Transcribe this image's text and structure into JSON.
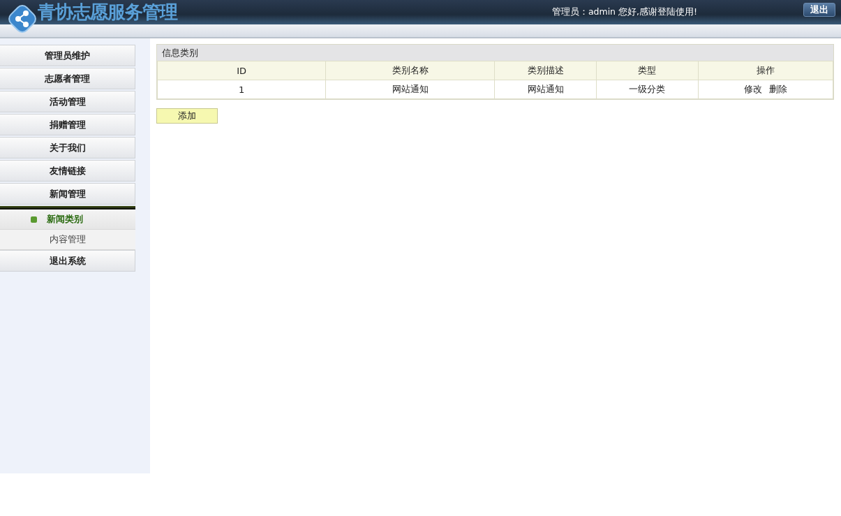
{
  "header": {
    "title": "青协志愿服务管理",
    "greeting": "管理员：admin 您好,感谢登陆使用!",
    "logout_button": "退出"
  },
  "sidebar": {
    "items": [
      {
        "label": "管理员维护"
      },
      {
        "label": "志愿者管理"
      },
      {
        "label": "活动管理"
      },
      {
        "label": "捐赠管理"
      },
      {
        "label": "关于我们"
      },
      {
        "label": "友情链接"
      },
      {
        "label": "新闻管理",
        "expanded": true,
        "children": [
          {
            "label": "新闻类别",
            "selected": true
          },
          {
            "label": "内容管理",
            "selected": false
          }
        ]
      },
      {
        "label": "退出系统"
      }
    ]
  },
  "panel": {
    "title": "信息类别",
    "table": {
      "columns": [
        "ID",
        "类别名称",
        "类别描述",
        "类型",
        "操作"
      ],
      "rows": [
        {
          "cells": [
            "1",
            "网站通知",
            "网站通知",
            "一级分类"
          ],
          "actions": [
            "修改",
            "删除"
          ]
        }
      ]
    },
    "add_button": "添加"
  }
}
